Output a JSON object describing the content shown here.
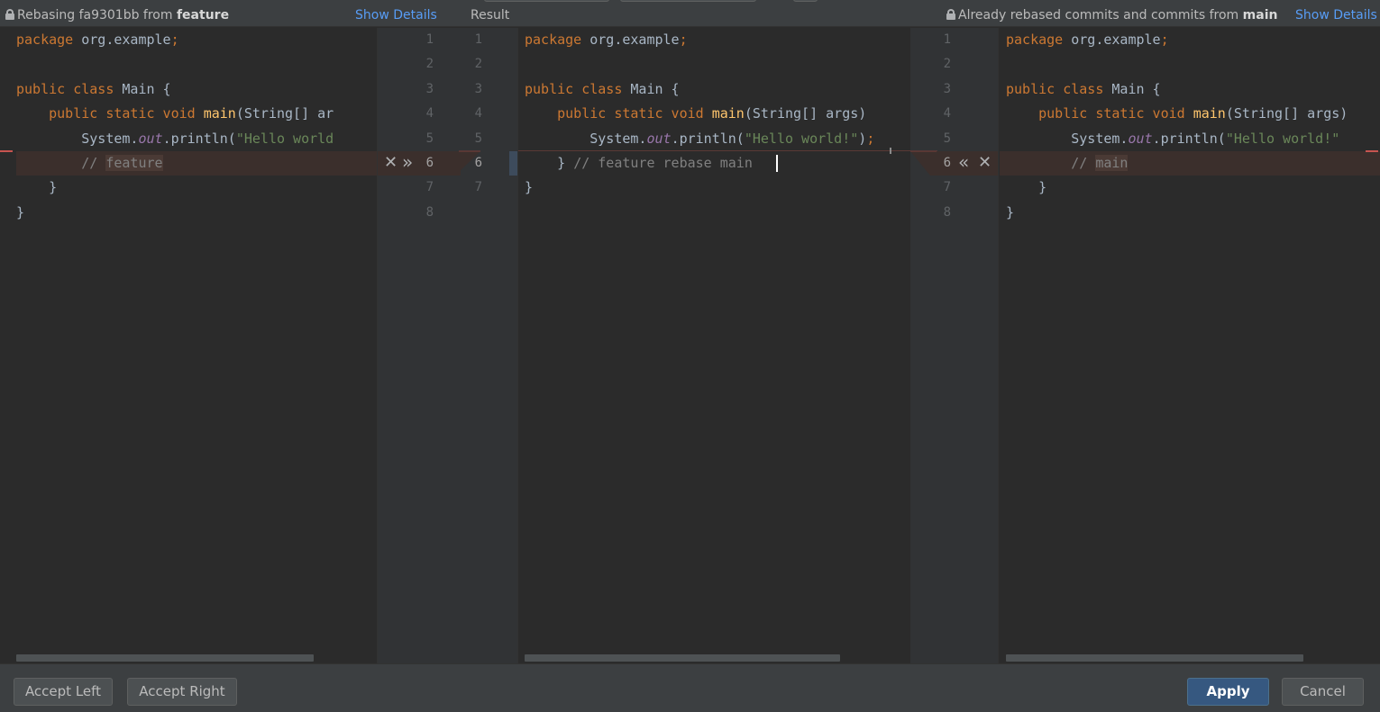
{
  "header": {
    "left_prefix": "Rebasing fa9301bb from ",
    "left_branch": "feature",
    "left_show_details": "Show Details",
    "result_label": "Result",
    "right_prefix": "Already rebased commits and commits from ",
    "right_branch": "main",
    "right_show_details": "Show Details"
  },
  "left_code": {
    "l1_kw": "package",
    "l1_rest": " org.example",
    "l1_semi": ";",
    "l3_kw": "public class",
    "l3_rest": " Main {",
    "l4_indent": "    ",
    "l4_kw": "public static void",
    "l4_fn": " main",
    "l4_rest": "(String[] ar",
    "l5_indent": "        ",
    "l5_a": "System.",
    "l5_fld": "out",
    "l5_b": ".println(",
    "l5_str": "\"Hello world",
    "l6_indent": "        ",
    "l6_cm": "// ",
    "l6_mark": "feature",
    "l7": "    }",
    "l8": "}"
  },
  "left_line_numbers": [
    "1",
    "2",
    "3",
    "4",
    "5",
    "6",
    "7",
    "8"
  ],
  "result_line_numbers": [
    "1",
    "2",
    "3",
    "4",
    "5",
    "6",
    "7"
  ],
  "result_code": {
    "l1_kw": "package",
    "l1_rest": " org.example",
    "l1_semi": ";",
    "l3_kw": "public class",
    "l3_rest": " Main {",
    "l4_indent": "    ",
    "l4_kw": "public static void",
    "l4_fn": " main",
    "l4_rest": "(String[] args)",
    "l5_indent": "        ",
    "l5_a": "System.",
    "l5_fld": "out",
    "l5_b": ".println(",
    "l5_str": "\"Hello world!\"",
    "l5_c": ")",
    "l5_semi": ";",
    "l6_a": "    } ",
    "l6_cm": "// feature rebase main",
    "l7": "}"
  },
  "right_line_numbers": [
    "1",
    "2",
    "3",
    "4",
    "5",
    "6",
    "7",
    "8"
  ],
  "right_code": {
    "l1_kw": "package",
    "l1_rest": " org.example",
    "l1_semi": ";",
    "l3_kw": "public class",
    "l3_rest": " Main {",
    "l4_indent": "    ",
    "l4_kw": "public static void",
    "l4_fn": " main",
    "l4_rest": "(String[] args)",
    "l5_indent": "        ",
    "l5_a": "System.",
    "l5_fld": "out",
    "l5_b": ".println(",
    "l5_str": "\"Hello world!\"",
    "l6_indent": "        ",
    "l6_cm": "// ",
    "l6_mark": "main",
    "l7": "    }",
    "l8": "}"
  },
  "icons": {
    "left_discard": "close-icon",
    "left_accept": "double-chevron-right-icon",
    "right_accept": "double-chevron-left-icon",
    "right_discard": "close-icon"
  },
  "buttons": {
    "accept_left": "Accept Left",
    "accept_right": "Accept Right",
    "apply": "Apply",
    "cancel": "Cancel"
  },
  "colors": {
    "conflict": "#3b2f2c",
    "primary_button": "#365880",
    "link": "#589df6"
  }
}
